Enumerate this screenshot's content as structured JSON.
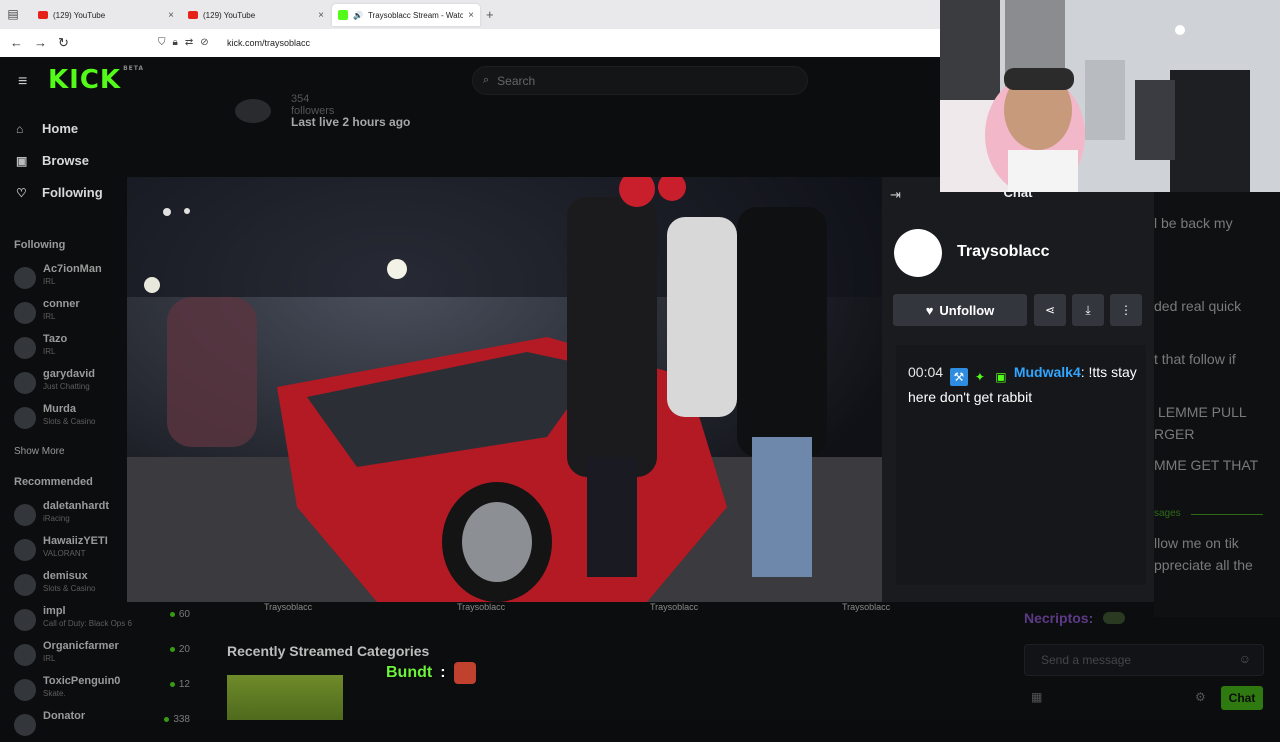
{
  "browser": {
    "tabs": [
      {
        "title": "(129) YouTube",
        "close": "×"
      },
      {
        "title": "(129) YouTube",
        "close": "×"
      },
      {
        "title": "Traysoblacc Stream - Watch",
        "close": "×",
        "audio": "🔊"
      }
    ],
    "new_tab": "+",
    "url": "kick.com/traysoblacc",
    "nav": {
      "back": "←",
      "forward": "→",
      "reload": "↻"
    }
  },
  "site": {
    "logo": "KICK",
    "logo_badge": "BETA",
    "search_placeholder": "Search"
  },
  "sidebar": {
    "nav": [
      {
        "label": "Home",
        "icon": "home-icon",
        "glyph": "⌂"
      },
      {
        "label": "Browse",
        "icon": "browse-icon",
        "glyph": "▣"
      },
      {
        "label": "Following",
        "icon": "heart-icon",
        "glyph": "♡"
      }
    ],
    "following_label": "Following",
    "following": [
      {
        "name": "Ac7ionMan",
        "category": "IRL"
      },
      {
        "name": "conner",
        "category": "IRL"
      },
      {
        "name": "Tazo",
        "category": "IRL"
      },
      {
        "name": "garydavid",
        "category": "Just Chatting"
      },
      {
        "name": "Murda",
        "category": "Slots & Casino"
      }
    ],
    "show_more": "Show More",
    "recommended_label": "Recommended",
    "recommended": [
      {
        "name": "daletanhardt",
        "category": "iRacing",
        "viewers": ""
      },
      {
        "name": "HawaiizYETI",
        "category": "VALORANT",
        "viewers": ""
      },
      {
        "name": "demisux",
        "category": "Slots & Casino",
        "viewers": ""
      },
      {
        "name": "impl",
        "category": "Call of Duty: Black Ops 6",
        "viewers": "60"
      },
      {
        "name": "Organicfarmer",
        "category": "IRL",
        "viewers": "20"
      },
      {
        "name": "ToxicPenguin0",
        "category": "Skate.",
        "viewers": "12"
      },
      {
        "name": "Donator",
        "category": "",
        "viewers": "338"
      }
    ]
  },
  "channel": {
    "followers": "354 followers",
    "last_live": "Last live 2 hours ago",
    "watermark": "Traysoblacc",
    "recent_categories": "Recently Streamed Categories"
  },
  "overlay": {
    "bundt_name": "Bundt",
    "bundt_sep": ":"
  },
  "chat": {
    "title": "Chat",
    "streamer": "Traysoblacc",
    "unfollow": "Unfollow",
    "message": {
      "time": "00:04",
      "user": "Mudwalk4",
      "text": ": !tts stay here don't get rabbit"
    },
    "background_lines": [
      "l be back my",
      "ded real quick",
      "t that follow if",
      "LEMME PULL",
      "RGER",
      "MME GET THAT",
      "sages",
      "llow me on tik",
      "ppreciate all the"
    ],
    "necriptos": "Necriptos:",
    "send_placeholder": "Send a message",
    "chat_button": "Chat"
  },
  "colors": {
    "kick_green": "#53fc18",
    "username_blue": "#31a6ff",
    "bundt_green": "#6df23c"
  }
}
